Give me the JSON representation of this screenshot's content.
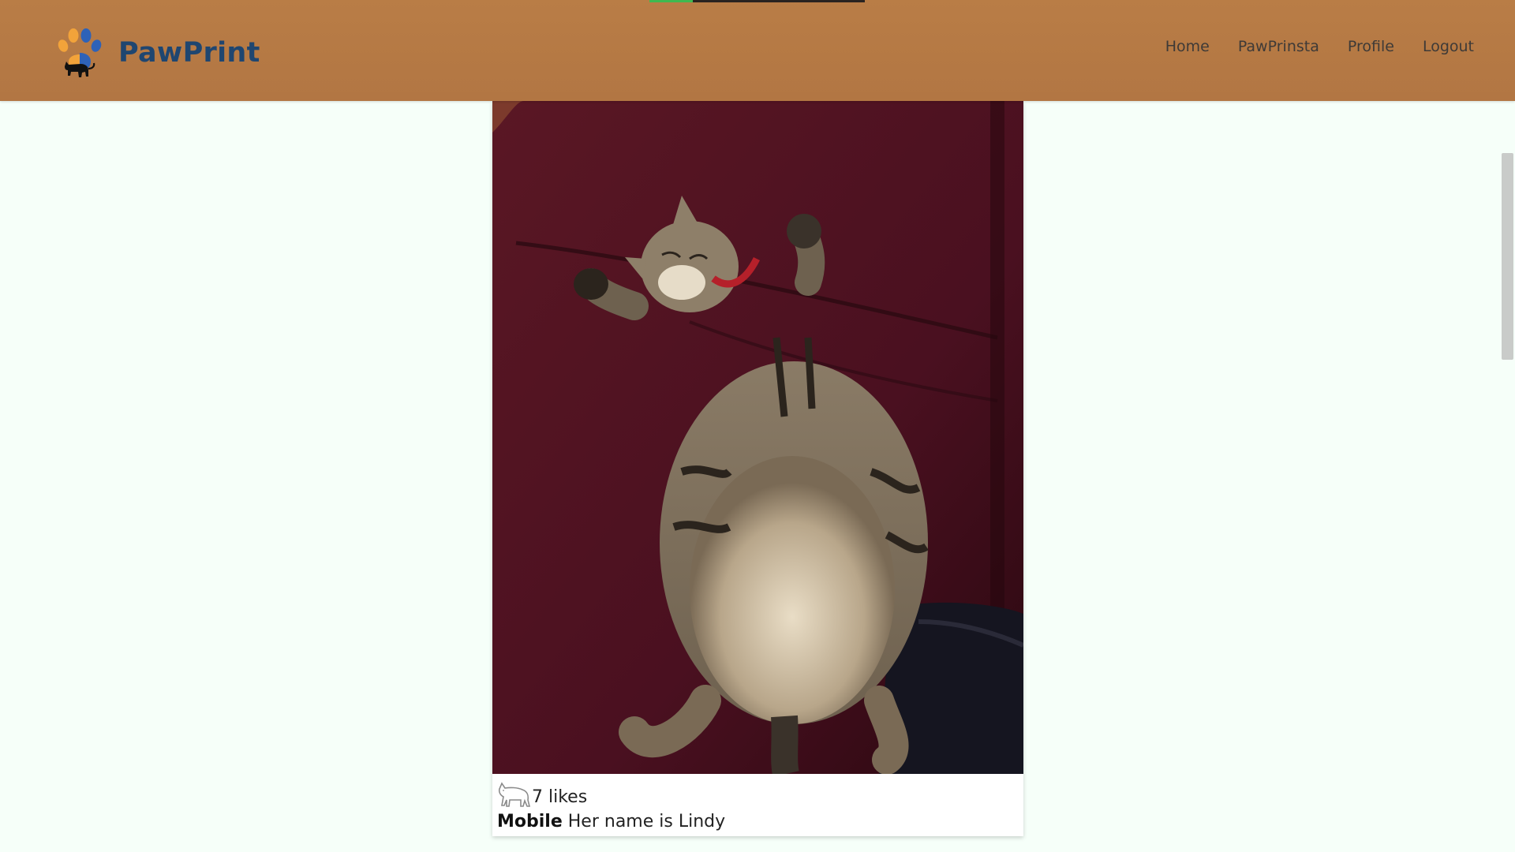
{
  "app": {
    "name": "PawPrint",
    "logo_icon": "paw-cat-logo-icon",
    "brand_color": "#1f4670",
    "header_color": "#b57a45",
    "page_background": "#f6fff9"
  },
  "nav": {
    "items": [
      {
        "label": "Home"
      },
      {
        "label": "PawPrinsta"
      },
      {
        "label": "Profile"
      },
      {
        "label": "Logout"
      }
    ]
  },
  "page_load_progress": {
    "fraction": 0.2,
    "fill_color": "#3fb950"
  },
  "post": {
    "photo_icon": "sleeping-tabby-cat-photo",
    "like_icon": "cat-outline-like-icon",
    "likes_text": "7 likes",
    "username": "Mobile",
    "caption": "Her name is Lindy"
  }
}
